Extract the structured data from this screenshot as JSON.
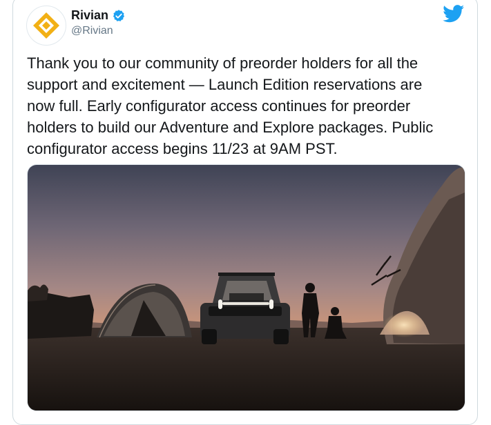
{
  "account": {
    "display_name": "Rivian",
    "handle": "@Rivian",
    "verified": true,
    "brand_color": "#f2b015"
  },
  "tweet": {
    "text": "Thank you to our community of preorder holders for all the\nsupport and excitement — Launch Edition reservations are\nnow full. Early configurator access continues for preorder\nholders to build our Adventure and Explore packages. Public\nconfigurator access begins 11/23 at 9AM PST."
  },
  "icons": {
    "platform": "twitter-bird-icon",
    "verified": "verified-badge-icon"
  },
  "colors": {
    "twitter_blue": "#1da1f2",
    "text": "#14171a",
    "secondary_text": "#657786"
  }
}
